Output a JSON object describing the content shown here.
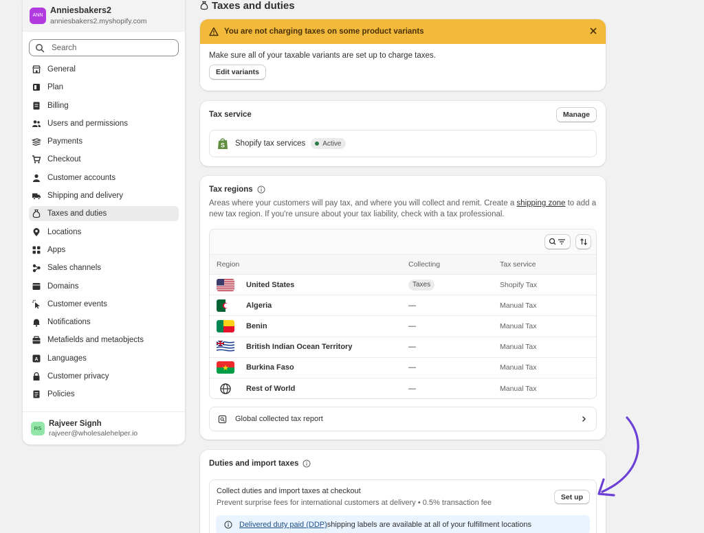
{
  "store": {
    "avatar": "ANN",
    "name": "Anniesbakers2",
    "url": "anniesbakers2.myshopify.com"
  },
  "search": {
    "placeholder": "Search"
  },
  "nav": [
    {
      "label": "General",
      "icon": "store-icon"
    },
    {
      "label": "Plan",
      "icon": "plan-icon"
    },
    {
      "label": "Billing",
      "icon": "billing-icon"
    },
    {
      "label": "Users and permissions",
      "icon": "users-icon"
    },
    {
      "label": "Payments",
      "icon": "payments-icon"
    },
    {
      "label": "Checkout",
      "icon": "cart-icon"
    },
    {
      "label": "Customer accounts",
      "icon": "person-icon"
    },
    {
      "label": "Shipping and delivery",
      "icon": "truck-icon"
    },
    {
      "label": "Taxes and duties",
      "icon": "tax-bag-icon",
      "active": true
    },
    {
      "label": "Locations",
      "icon": "location-pin-icon"
    },
    {
      "label": "Apps",
      "icon": "apps-icon"
    },
    {
      "label": "Sales channels",
      "icon": "sales-channels-icon"
    },
    {
      "label": "Domains",
      "icon": "domains-icon"
    },
    {
      "label": "Customer events",
      "icon": "cursor-icon"
    },
    {
      "label": "Notifications",
      "icon": "bell-icon"
    },
    {
      "label": "Metafields and metaobjects",
      "icon": "metafields-icon"
    },
    {
      "label": "Languages",
      "icon": "languages-icon"
    },
    {
      "label": "Customer privacy",
      "icon": "lock-icon"
    },
    {
      "label": "Policies",
      "icon": "policies-icon"
    }
  ],
  "user": {
    "initials": "RS",
    "name": "Rajveer Signh",
    "email": "rajveer@wholesalehelper.io"
  },
  "page": {
    "title": "Taxes and duties"
  },
  "banner": {
    "title": "You are not charging taxes on some product variants",
    "body": "Make sure all of your taxable variants are set up to charge taxes.",
    "button": "Edit variants",
    "color": "#f2b93b"
  },
  "tax_service": {
    "title": "Tax service",
    "manage": "Manage",
    "service_name": "Shopify tax services",
    "status": "Active",
    "status_color": "#2f7a4b"
  },
  "tax_regions": {
    "title": "Tax regions",
    "desc_1": "Areas where your customers will pay tax, and where you will collect and remit. Create a ",
    "desc_link": "shipping zone",
    "desc_2": " to add a new tax region. If you're unsure about your tax liability, check with a tax professional.",
    "columns": [
      "Region",
      "Collecting",
      "Tax service"
    ],
    "rows": [
      {
        "region": "United States",
        "collecting": "Taxes",
        "service": "Shopify Tax",
        "flag": "us"
      },
      {
        "region": "Algeria",
        "collecting": "—",
        "service": "Manual Tax",
        "flag": "dz"
      },
      {
        "region": "Benin",
        "collecting": "—",
        "service": "Manual Tax",
        "flag": "bj"
      },
      {
        "region": "British Indian Ocean Territory",
        "collecting": "—",
        "service": "Manual Tax",
        "flag": "io"
      },
      {
        "region": "Burkina Faso",
        "collecting": "—",
        "service": "Manual Tax",
        "flag": "bf"
      },
      {
        "region": "Rest of World",
        "collecting": "—",
        "service": "Manual Tax",
        "flag": "globe"
      }
    ],
    "report": "Global collected tax report"
  },
  "duties": {
    "title": "Duties and import taxes",
    "collect_title": "Collect duties and import taxes at checkout",
    "collect_desc": "Prevent surprise fees for international customers at delivery • 0.5% transaction fee",
    "setup": "Set up",
    "info_link": "Delivered duty paid (DDP)",
    "info_rest": " shipping labels are available at all of your fulfillment locations"
  },
  "arrow_color": "#6c3fd6"
}
